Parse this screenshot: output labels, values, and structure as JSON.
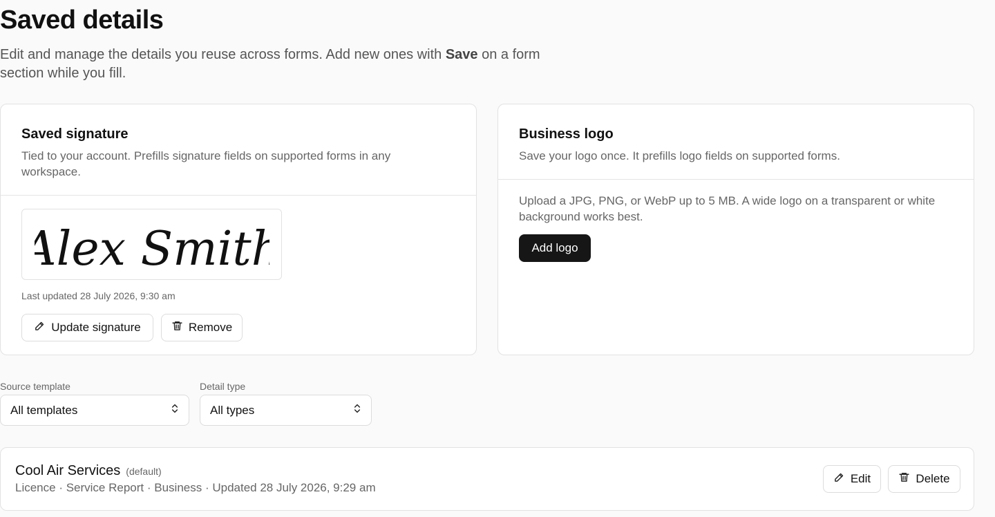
{
  "header": {
    "title": "Saved details",
    "subtitle_before": "Edit and manage the details you reuse across forms. Add new ones with ",
    "subtitle_bold": "Save",
    "subtitle_after": " on a form section while you fill."
  },
  "signature_card": {
    "title": "Saved signature",
    "description": "Tied to your account. Prefills signature fields on supported forms in any workspace.",
    "signature_text": "Alex Smith",
    "last_updated": "Last updated 28 July 2026, 9:30 am",
    "update_label": "Update signature",
    "remove_label": "Remove",
    "update_icon": "pencil-icon",
    "remove_icon": "trash-icon"
  },
  "logo_card": {
    "title": "Business logo",
    "description": "Save your logo once. It prefills logo fields on supported forms.",
    "help": "Upload a JPG, PNG, or WebP up to 5 MB. A wide logo on a transparent or white background works best.",
    "add_label": "Add logo"
  },
  "filters": {
    "source_label": "Source template",
    "source_value": "All templates",
    "type_label": "Detail type",
    "type_value": "All types"
  },
  "saved_items": [
    {
      "name": "Cool Air Services",
      "badge": "(default)",
      "meta": "Licence · Service Report · Business · Updated 28 July 2026, 9:29 am",
      "edit_label": "Edit",
      "delete_label": "Delete"
    }
  ],
  "colors": {
    "background": "#fafafa",
    "card": "#ffffff",
    "border": "#e2e2e2",
    "primary_button": "#161616",
    "text_muted": "#666666"
  }
}
